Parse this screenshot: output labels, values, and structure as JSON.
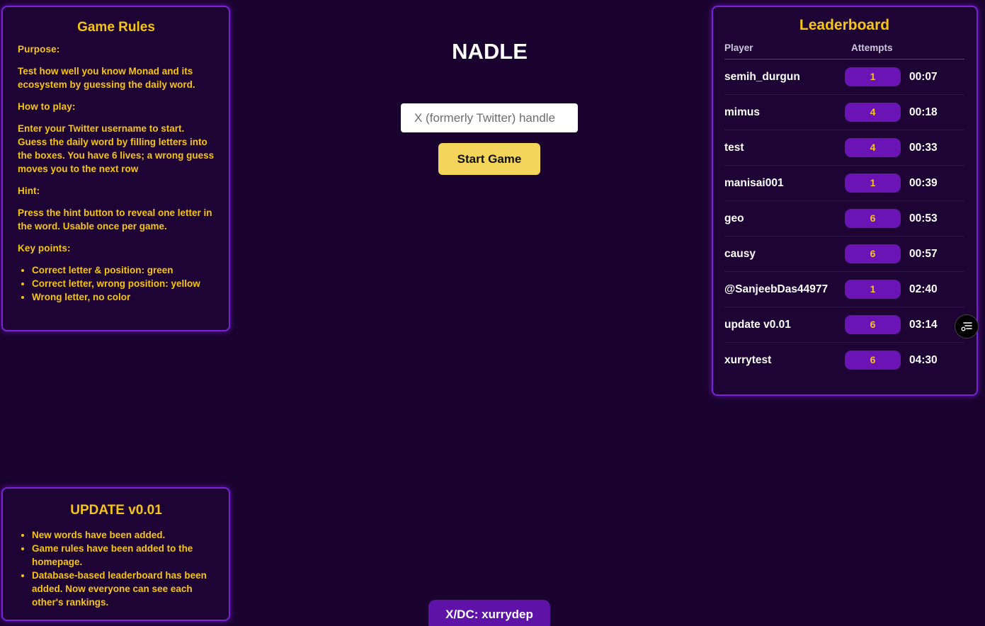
{
  "rules": {
    "title": "Game Rules",
    "purpose_heading": "Purpose:",
    "purpose_text": "Test how well you know Monad and its ecosystem by guessing the daily word.",
    "howto_heading": "How to play:",
    "howto_text": "Enter your Twitter username to start. Guess the daily word by filling letters into the boxes. You have 6 lives; a wrong guess moves you to the next row",
    "hint_heading": "Hint:",
    "hint_text": "Press the hint button to reveal one letter in the word. Usable once per game.",
    "keypoints_heading": "Key points:",
    "keypoints": [
      "Correct letter & position: green",
      "Correct letter, wrong position: yellow",
      "Wrong letter, no color"
    ]
  },
  "update": {
    "title": "UPDATE v0.01",
    "items": [
      "New words have been added.",
      "Game rules have been added to the homepage.",
      "Database-based leaderboard has been added. Now everyone can see each other's rankings."
    ]
  },
  "main": {
    "title": "NADLE",
    "handle_placeholder": "X (formerly Twitter) handle",
    "start_label": "Start Game"
  },
  "leaderboard": {
    "title": "Leaderboard",
    "col_player": "Player",
    "col_attempts": "Attempts",
    "rows": [
      {
        "player": "semih_durgun",
        "attempts": "1",
        "time": "00:07"
      },
      {
        "player": "mimus",
        "attempts": "4",
        "time": "00:18"
      },
      {
        "player": "test",
        "attempts": "4",
        "time": "00:33"
      },
      {
        "player": "manisai001",
        "attempts": "1",
        "time": "00:39"
      },
      {
        "player": "geo",
        "attempts": "6",
        "time": "00:53"
      },
      {
        "player": "causy",
        "attempts": "6",
        "time": "00:57"
      },
      {
        "player": "@SanjeebDas44977",
        "attempts": "1",
        "time": "02:40"
      },
      {
        "player": "update v0.01",
        "attempts": "6",
        "time": "03:14"
      },
      {
        "player": "xurrytest",
        "attempts": "6",
        "time": "04:30"
      }
    ]
  },
  "footer": {
    "credit": "X/DC: xurrydep"
  },
  "icons": {
    "filter": "filter-settings-icon"
  },
  "colors": {
    "background": "#1b0330",
    "accent_yellow": "#f5c518",
    "panel_border": "#7a22d8",
    "badge_purple": "#6a14b6",
    "button_yellow": "#f2d55a"
  }
}
